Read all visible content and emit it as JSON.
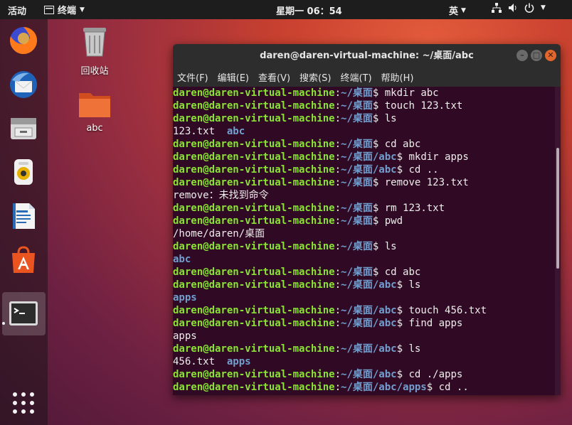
{
  "topbar": {
    "activities": "活动",
    "app_menu": "终端",
    "clock": "星期一 06：54",
    "input_method": "英"
  },
  "desktop": {
    "trash_label": "回收站",
    "folder_label": "abc"
  },
  "terminal": {
    "title": "daren@daren-virtual-machine: ~/桌面/abc",
    "menu": [
      "文件(F)",
      "编辑(E)",
      "查看(V)",
      "搜索(S)",
      "终端(T)",
      "帮助(H)"
    ],
    "lines": [
      {
        "user": "daren@daren-virtual-machine",
        "path": "~/桌面",
        "cmd": " mkdir abc"
      },
      {
        "user": "daren@daren-virtual-machine",
        "path": "~/桌面",
        "cmd": " touch 123.txt"
      },
      {
        "user": "daren@daren-virtual-machine",
        "path": "~/桌面",
        "cmd": " ls"
      },
      {
        "text": "123.txt  ",
        "dir": "abc"
      },
      {
        "user": "daren@daren-virtual-machine",
        "path": "~/桌面",
        "cmd": " cd abc"
      },
      {
        "user": "daren@daren-virtual-machine",
        "path": "~/桌面/abc",
        "cmd": " mkdir apps"
      },
      {
        "user": "daren@daren-virtual-machine",
        "path": "~/桌面/abc",
        "cmd": " cd .."
      },
      {
        "user": "daren@daren-virtual-machine",
        "path": "~/桌面",
        "cmd": " remove 123.txt"
      },
      {
        "text": "remove：未找到命令"
      },
      {
        "user": "daren@daren-virtual-machine",
        "path": "~/桌面",
        "cmd": " rm 123.txt"
      },
      {
        "user": "daren@daren-virtual-machine",
        "path": "~/桌面",
        "cmd": " pwd"
      },
      {
        "text": "/home/daren/桌面"
      },
      {
        "user": "daren@daren-virtual-machine",
        "path": "~/桌面",
        "cmd": " ls"
      },
      {
        "dir": "abc"
      },
      {
        "user": "daren@daren-virtual-machine",
        "path": "~/桌面",
        "cmd": " cd abc"
      },
      {
        "user": "daren@daren-virtual-machine",
        "path": "~/桌面/abc",
        "cmd": " ls"
      },
      {
        "dir": "apps"
      },
      {
        "user": "daren@daren-virtual-machine",
        "path": "~/桌面/abc",
        "cmd": " touch 456.txt"
      },
      {
        "user": "daren@daren-virtual-machine",
        "path": "~/桌面/abc",
        "cmd": " find apps"
      },
      {
        "text": "apps"
      },
      {
        "user": "daren@daren-virtual-machine",
        "path": "~/桌面/abc",
        "cmd": " ls"
      },
      {
        "text": "456.txt  ",
        "dir": "apps"
      },
      {
        "user": "daren@daren-virtual-machine",
        "path": "~/桌面/abc",
        "cmd": " cd ./apps"
      },
      {
        "user": "daren@daren-virtual-machine",
        "path": "~/桌面/abc/apps",
        "cmd": " cd .."
      }
    ]
  },
  "icons": {
    "dock": [
      "firefox-icon",
      "thunderbird-icon",
      "files-icon",
      "rhythmbox-icon",
      "libreoffice-writer-icon",
      "software-center-icon",
      "terminal-icon",
      "show-apps-icon"
    ],
    "system": [
      "network-icon",
      "volume-icon",
      "power-icon"
    ]
  },
  "colors": {
    "terminal_bg": "#300a24",
    "prompt_user": "#8ae234",
    "prompt_path": "#729fcf",
    "topbar": "#1d1d1d",
    "close_button": "#e1672c"
  }
}
